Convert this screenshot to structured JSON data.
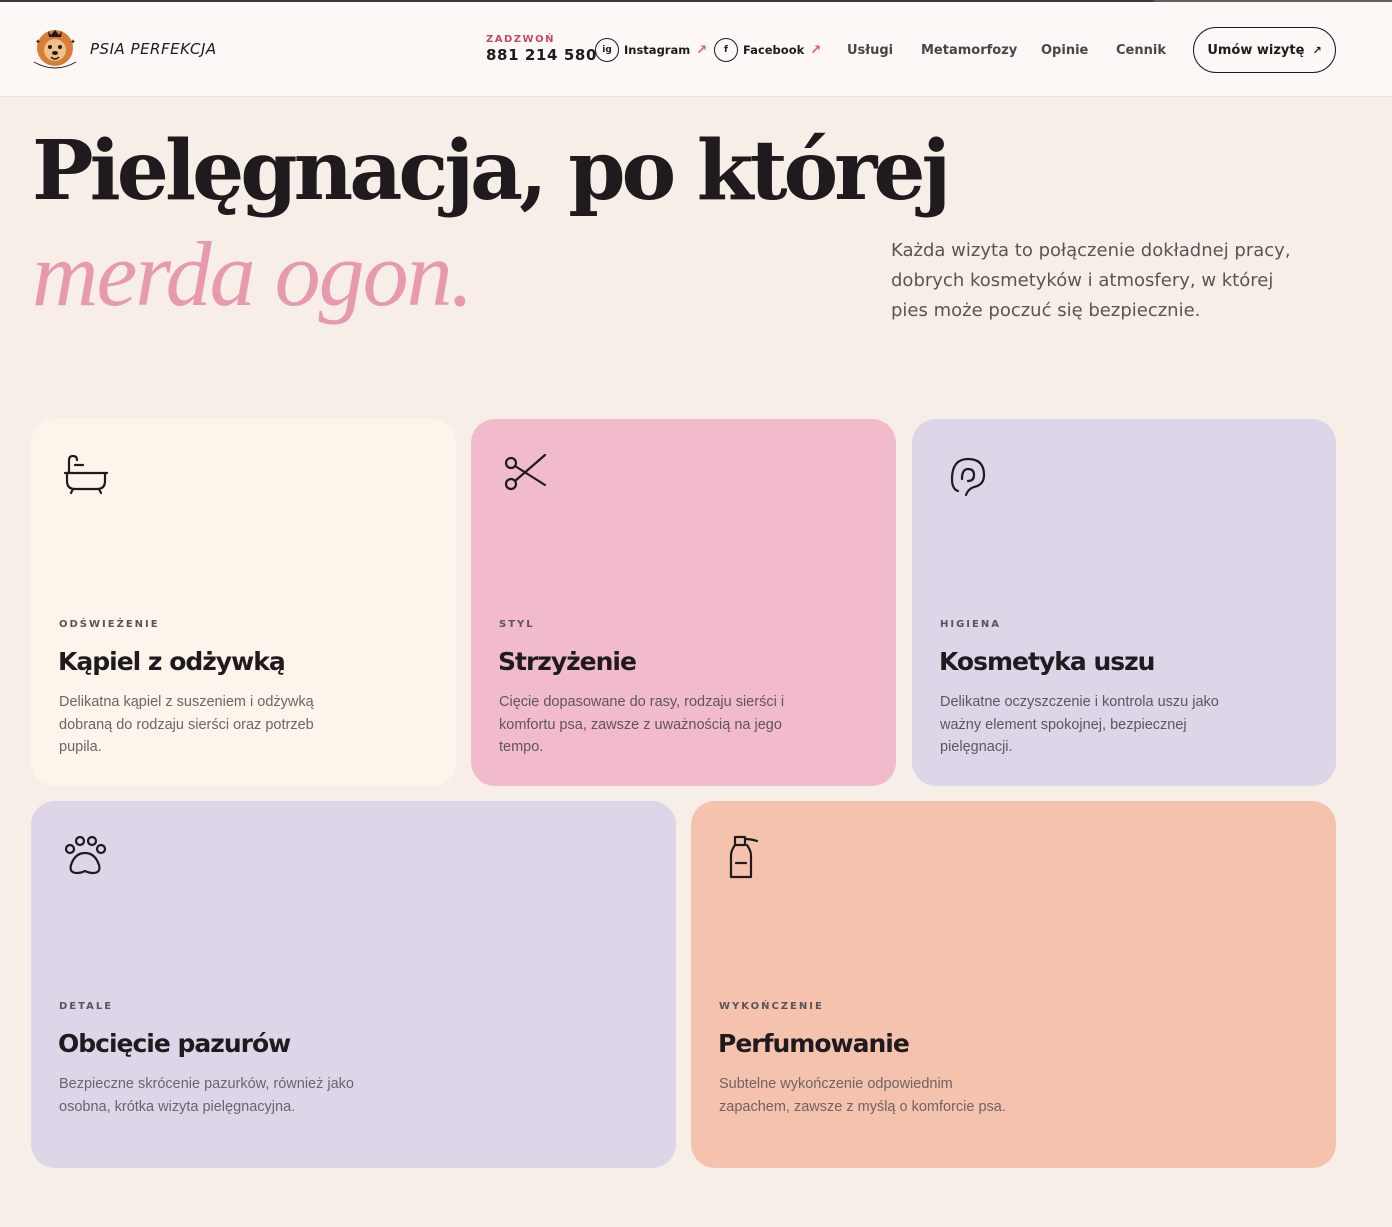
{
  "header": {
    "brand": "PSIA PERFEKCJA",
    "call_label": "ZADZWOŃ",
    "call_number": "881 214 580",
    "instagram": {
      "icon_text": "ig",
      "label": "Instagram",
      "arrow": "↗"
    },
    "facebook": {
      "icon_text": "f",
      "label": "Facebook",
      "arrow": "↗"
    },
    "nav": [
      "Usługi",
      "Metamorfozy",
      "Opinie",
      "Cennik"
    ],
    "cta_label": "Umów wizytę",
    "cta_arrow": "↗"
  },
  "hero": {
    "title": "Pielęgnacja, po której",
    "accent": "merda ogon.",
    "description": "Każda wizyta to połączenie dokładnej pracy, dobrych kosmetyków i atmosfery, w której pies może poczuć się bezpiecznie."
  },
  "services": [
    {
      "icon": "bathtub-icon",
      "kicker": "ODŚWIEŻENIE",
      "title": "Kąpiel z odżywką",
      "text": "Delikatna kąpiel z suszeniem i odżywką dobraną do rodzaju sierści oraz potrzeb pupila.",
      "color": "#fdf5eb"
    },
    {
      "icon": "scissors-icon",
      "kicker": "STYL",
      "title": "Strzyżenie",
      "text": "Cięcie dopasowane do rasy, rodzaju sierści i komfortu psa, zawsze z uważnością na jego tempo.",
      "color": "#f1bbcc"
    },
    {
      "icon": "ear-icon",
      "kicker": "HIGIENA",
      "title": "Kosmetyka uszu",
      "text": "Delikatne oczyszczenie i kontrola uszu jako ważny element spokojnej, bezpiecznej pielęgnacji.",
      "color": "#ddd5e8"
    },
    {
      "icon": "paw-icon",
      "kicker": "DETALE",
      "title": "Obcięcie pazurów",
      "text": "Bezpieczne skrócenie pazurków, również jako osobna, krótka wizyta pielęgnacyjna.",
      "color": "#ddd5e8"
    },
    {
      "icon": "spray-bottle-icon",
      "kicker": "WYKOŃCZENIE",
      "title": "Perfumowanie",
      "text": "Subtelne wykończenie odpowiednim zapachem, zawsze z myślą o komforcie psa.",
      "color": "#f5c2ae"
    }
  ],
  "colors": {
    "accent_pink": "#e79aaf",
    "call_label": "#c9476e",
    "background": "#f7efe7"
  }
}
